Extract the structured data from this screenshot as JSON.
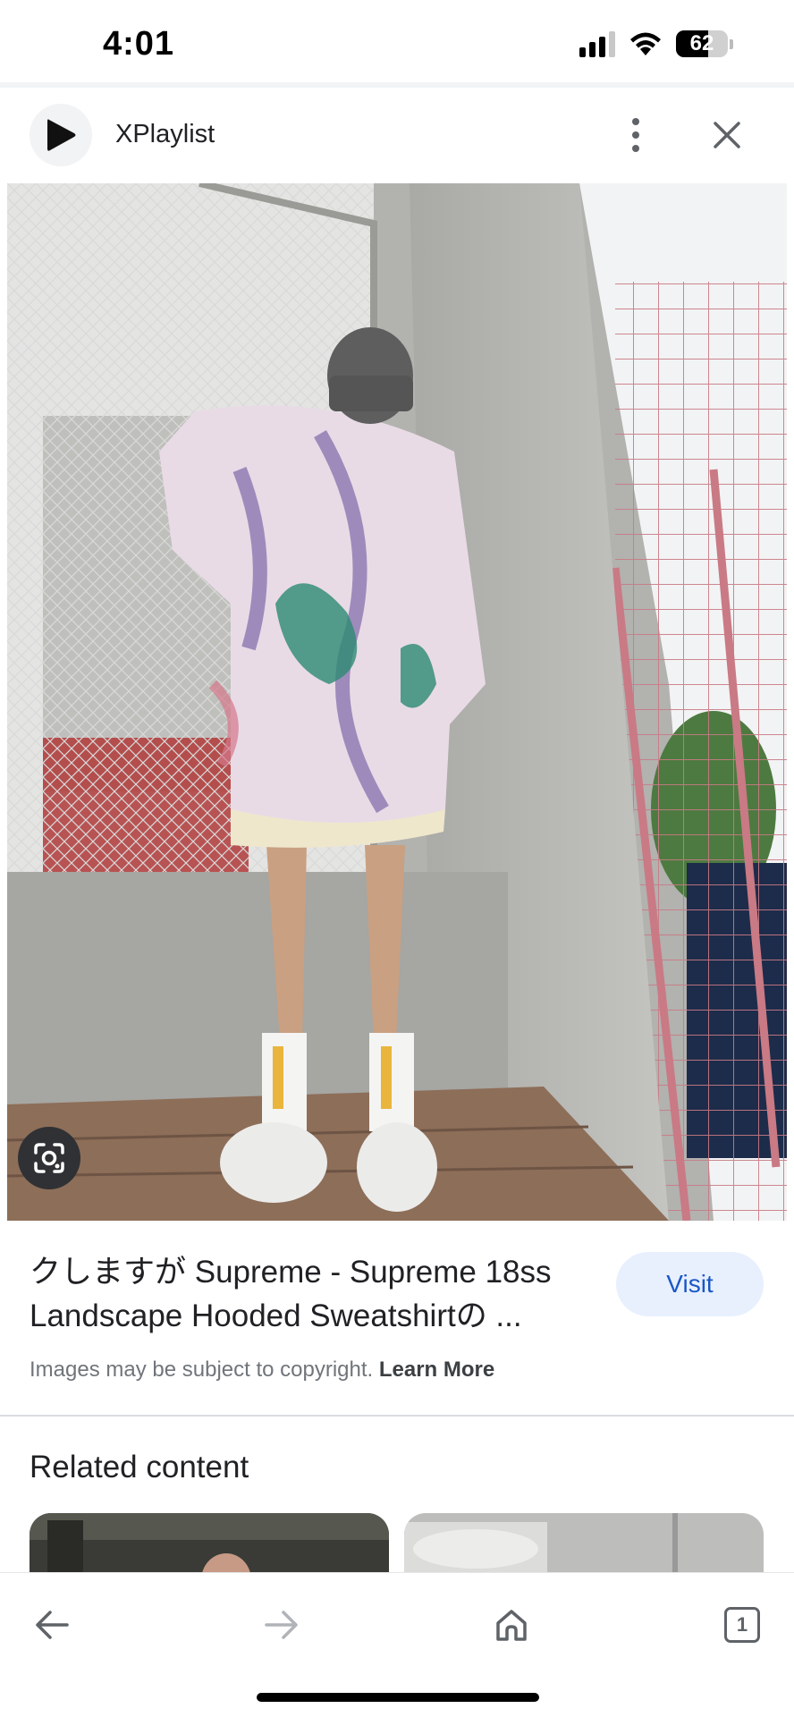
{
  "status_bar": {
    "time": "4:01",
    "battery_level": "62",
    "icons": [
      "cellular-signal-icon",
      "wifi-icon",
      "battery-icon"
    ]
  },
  "header": {
    "source_name": "XPlaylist",
    "icons": [
      "play-logo-icon",
      "more-vert-icon",
      "close-icon"
    ]
  },
  "image": {
    "lens_icon": "google-lens-icon"
  },
  "result": {
    "title": "クしますが Supreme - Supreme 18ss Landscape Hooded Sweatshirtの ...",
    "visit_label": "Visit",
    "copyright_text": "Images may be subject to copyright.",
    "learn_more_label": "Learn More"
  },
  "related": {
    "heading": "Related content"
  },
  "bottom_nav": {
    "tab_count": "1",
    "icons": [
      "back-arrow-icon",
      "forward-arrow-icon",
      "home-icon",
      "tabs-icon"
    ]
  },
  "colors": {
    "accent": "#1a57c4",
    "visit_bg": "#e8f0fe",
    "text_primary": "#202124",
    "text_secondary": "#70757a"
  }
}
